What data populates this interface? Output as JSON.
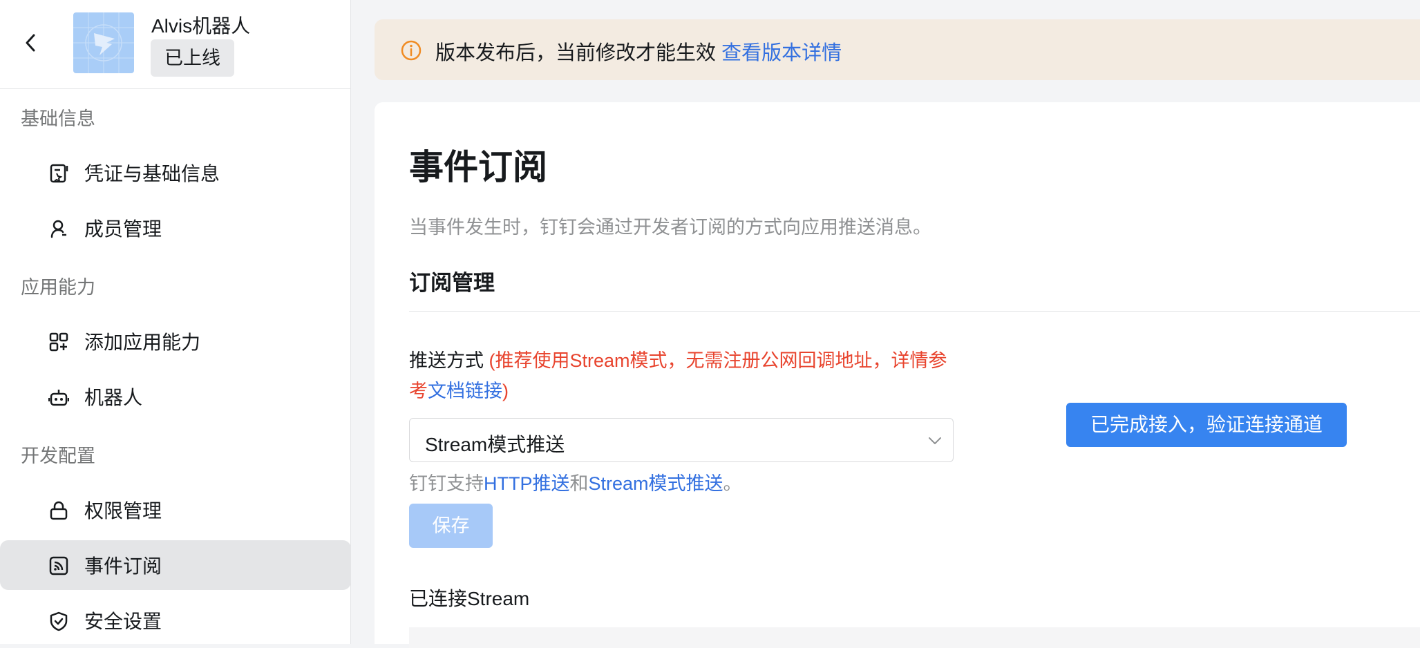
{
  "app": {
    "name": "Alvis机器人",
    "status": "已上线",
    "avatar_icon": "dingtalk-logo"
  },
  "sidebar": {
    "groups": [
      {
        "title": "基础信息",
        "items": [
          {
            "label": "凭证与基础信息",
            "icon": "document-icon"
          },
          {
            "label": "成员管理",
            "icon": "user-icon"
          }
        ]
      },
      {
        "title": "应用能力",
        "items": [
          {
            "label": "添加应用能力",
            "icon": "grid-add-icon"
          },
          {
            "label": "机器人",
            "icon": "robot-icon"
          }
        ]
      },
      {
        "title": "开发配置",
        "items": [
          {
            "label": "权限管理",
            "icon": "lock-icon"
          },
          {
            "label": "事件订阅",
            "icon": "rss-icon",
            "active": true
          },
          {
            "label": "安全设置",
            "icon": "shield-icon"
          }
        ]
      }
    ]
  },
  "notice": {
    "text": "版本发布后，当前修改才能生效",
    "link": "查看版本详情"
  },
  "page": {
    "title": "事件订阅",
    "description": "当事件发生时，钉钉会通过开发者订阅的方式向应用推送消息。",
    "section_title": "订阅管理",
    "field_label": "推送方式",
    "hint_prefix": "(推荐使用Stream模式，无需注册公网回调地址，详情参考",
    "hint_link": "文档链接",
    "hint_suffix": ")",
    "select_value": "Stream模式推送",
    "verify_button": "已完成接入，验证连接通道",
    "support_prefix": "钉钉支持",
    "support_link1": "HTTP推送",
    "support_mid": "和",
    "support_link2": "Stream模式推送",
    "support_suffix": "。",
    "save_button": "保存",
    "connected_title": "已连接Stream"
  },
  "colors": {
    "accent": "#3784f0",
    "link": "#3370e0",
    "warning_text": "#e8442e",
    "notice_bg": "#f3ebe1"
  }
}
